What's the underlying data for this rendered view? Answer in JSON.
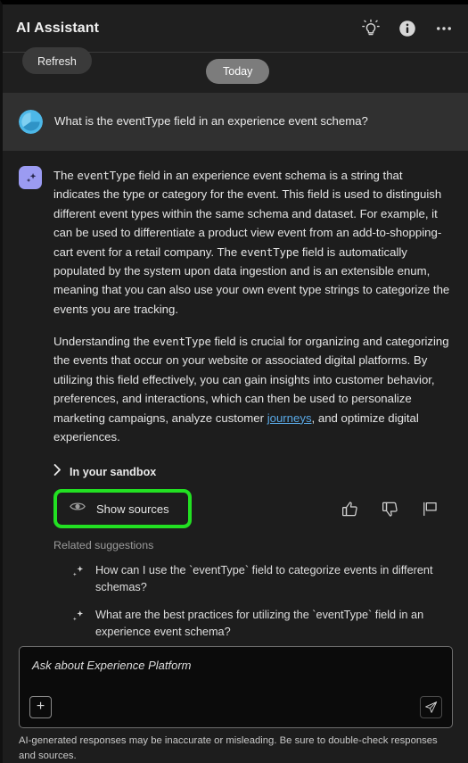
{
  "window": {
    "title": "AI Assistant"
  },
  "header": {
    "title": "AI Assistant",
    "icons": [
      {
        "name": "lightbulb-icon",
        "label": "Tips"
      },
      {
        "name": "info-icon",
        "label": "Information"
      },
      {
        "name": "more-options-icon",
        "label": "More options"
      }
    ]
  },
  "toolbar": {
    "refresh_label": "Refresh",
    "date_chip_label": "Today"
  },
  "conversation": {
    "user_message": {
      "avatar": "user-avatar",
      "text": "What is the eventType field in an experience event schema?"
    },
    "assistant_message": {
      "avatar": "ai-sparkle-avatar",
      "paragraph1": {
        "s1": "The ",
        "code1": "eventType",
        "s2": " field in an experience event schema is a string that indicates the type or category for the event. This field is used to distinguish different event types within the same schema and dataset. For example, it can be used to differentiate a product view event from an add-to-shopping-cart event for a retail company. The ",
        "code2": "eventType",
        "s3": " field is automatically populated by the system upon data ingestion and is an extensible enum, meaning that you can also use your own event type strings to categorize the events you are tracking."
      },
      "paragraph2": {
        "s1": "Understanding the ",
        "code1": "eventType",
        "s2": " field is crucial for organizing and categorizing the events that occur on your website or associated digital platforms. By utilizing this field effectively, you can gain insights into customer behavior, preferences, and interactions, which can then be used to personalize marketing campaigns, analyze customer ",
        "link": "journeys",
        "s3": ", and optimize digital experiences."
      },
      "sandbox_label": "In your sandbox",
      "show_sources_label": "Show sources",
      "feedback": {
        "thumbs_up": "Good response",
        "thumbs_down": "Bad response",
        "report": "Report"
      },
      "related_title": "Related suggestions",
      "suggestions": [
        "How can I use the `eventType` field to categorize events in different schemas?",
        "What are the best practices for utilizing the `eventType` field in an experience event schema?"
      ]
    }
  },
  "composer": {
    "placeholder": "Ask about Experience Platform",
    "add_button_label": "+",
    "send_button_label": "Send"
  },
  "footer": {
    "disclaimer": "AI-generated responses may be inaccurate or misleading. Be sure to double-check responses and sources."
  },
  "colors": {
    "background": "#1d1d1d",
    "header_bg": "#1f1f1f",
    "user_row_bg": "#303030",
    "highlight_green": "#22e022",
    "link_blue": "#5aa9e6",
    "ai_avatar": "#9b9bf2",
    "user_avatar": "#4db8e8"
  }
}
